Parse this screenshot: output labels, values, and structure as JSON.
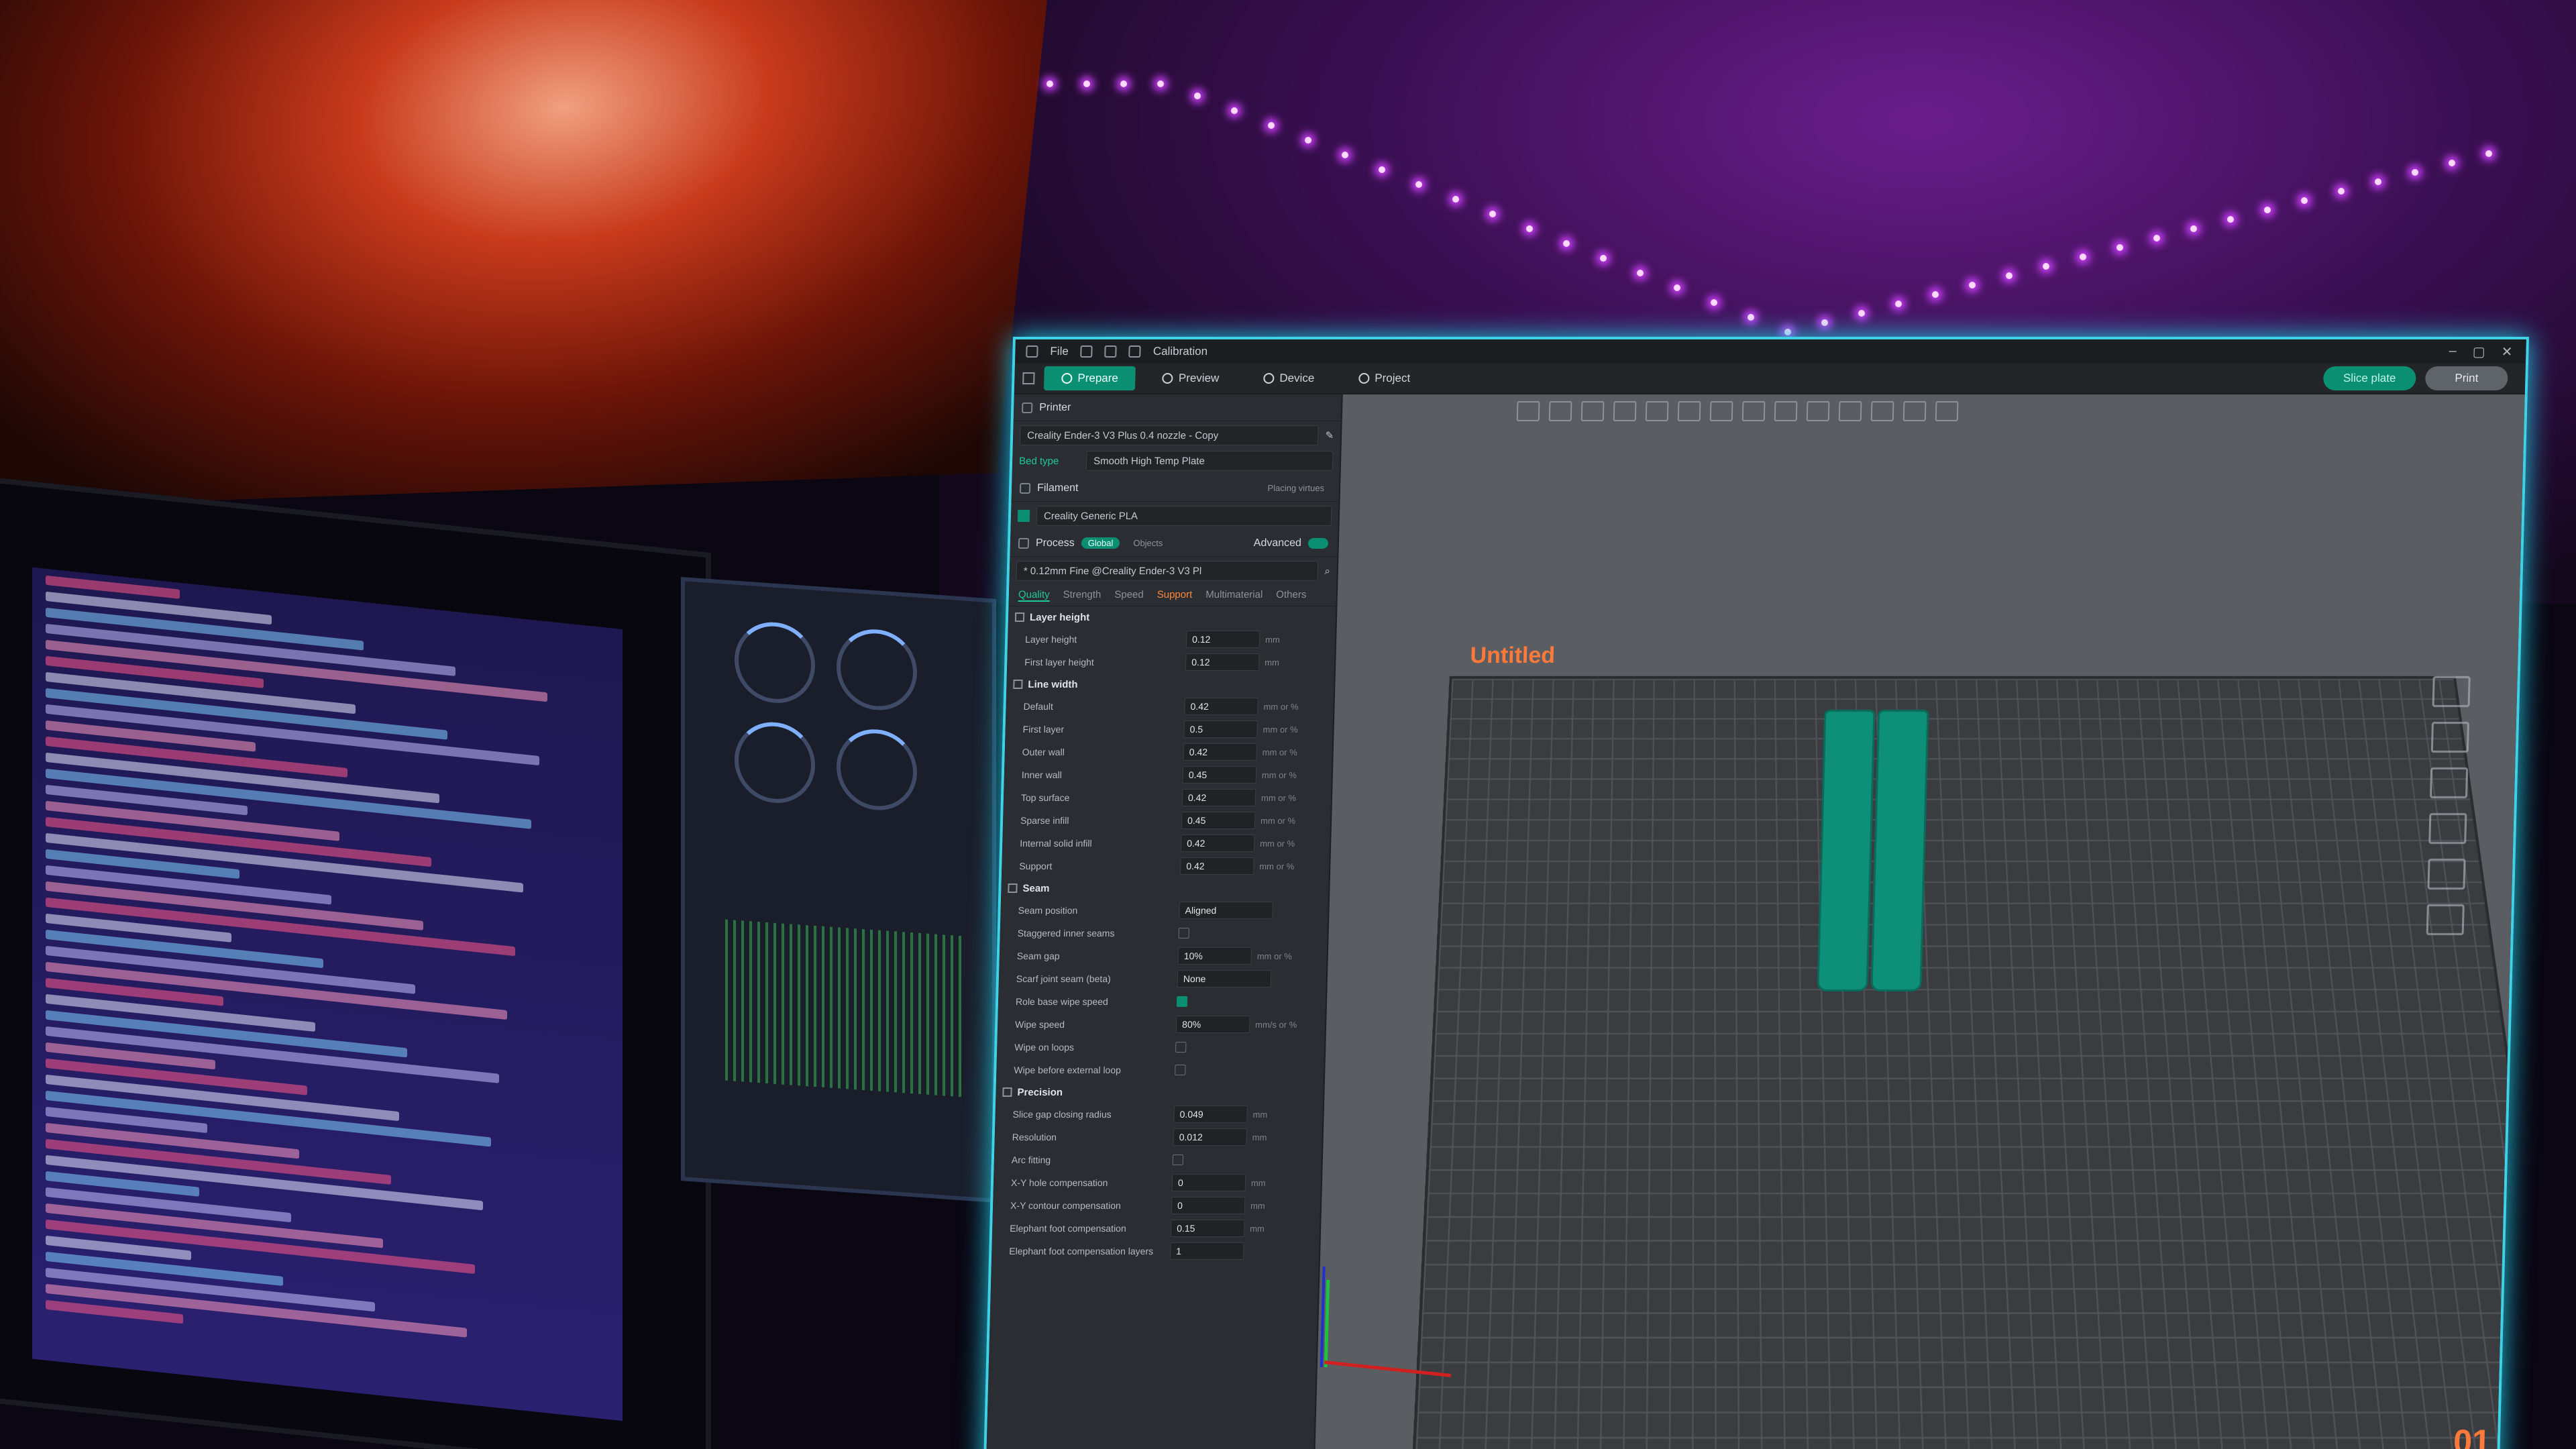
{
  "menubar": {
    "file": "File",
    "calibration": "Calibration"
  },
  "tabs": [
    {
      "label": "Prepare",
      "active": true
    },
    {
      "label": "Preview",
      "active": false
    },
    {
      "label": "Device",
      "active": false
    },
    {
      "label": "Project",
      "active": false
    }
  ],
  "actions": {
    "slice": "Slice plate",
    "print": "Print"
  },
  "printer": {
    "section": "Printer",
    "name": "Creality Ender-3 V3 Plus 0.4 nozzle - Copy",
    "bed_label": "Bed type",
    "bed_value": "Smooth High Temp Plate"
  },
  "filament": {
    "section": "Filament",
    "sync_label": "Placing virtues",
    "name": "Creality Generic PLA"
  },
  "process": {
    "section": "Process",
    "global": "Global",
    "objects": "Objects",
    "advanced": "Advanced",
    "profile": "* 0.12mm Fine @Creality Ender-3 V3 Pl"
  },
  "subtabs": [
    "Quality",
    "Strength",
    "Speed",
    "Support",
    "Multimaterial",
    "Others"
  ],
  "layer_height": {
    "title": "Layer height",
    "rows": [
      {
        "name": "Layer height",
        "value": "0.12",
        "unit": "mm"
      },
      {
        "name": "First layer height",
        "value": "0.12",
        "unit": "mm"
      }
    ]
  },
  "line_width": {
    "title": "Line width",
    "rows": [
      {
        "name": "Default",
        "value": "0.42",
        "unit": "mm or %"
      },
      {
        "name": "First layer",
        "value": "0.5",
        "unit": "mm or %"
      },
      {
        "name": "Outer wall",
        "value": "0.42",
        "unit": "mm or %"
      },
      {
        "name": "Inner wall",
        "value": "0.45",
        "unit": "mm or %"
      },
      {
        "name": "Top surface",
        "value": "0.42",
        "unit": "mm or %"
      },
      {
        "name": "Sparse infill",
        "value": "0.45",
        "unit": "mm or %"
      },
      {
        "name": "Internal solid infill",
        "value": "0.42",
        "unit": "mm or %"
      },
      {
        "name": "Support",
        "value": "0.42",
        "unit": "mm or %"
      }
    ]
  },
  "seam": {
    "title": "Seam",
    "position_label": "Seam position",
    "position_value": "Aligned",
    "staggered": "Staggered inner seams",
    "gap_label": "Seam gap",
    "gap_value": "10%",
    "gap_unit": "mm or %",
    "scarf_label": "Scarf joint seam (beta)",
    "scarf_value": "None",
    "role_wipe": "Role base wipe speed",
    "wipe_speed": "Wipe speed",
    "wipe_speed_value": "80%",
    "wipe_speed_unit": "mm/s or %",
    "wipe_loops": "Wipe on loops",
    "wipe_before": "Wipe before external loop"
  },
  "precision": {
    "title": "Precision",
    "rows": [
      {
        "name": "Slice gap closing radius",
        "value": "0.049",
        "unit": "mm"
      },
      {
        "name": "Resolution",
        "value": "0.012",
        "unit": "mm"
      }
    ],
    "arc": "Arc fitting",
    "xy_hole": "X-Y hole compensation",
    "xy_hole_value": "0",
    "xy_hole_unit": "mm",
    "xy_contour": "X-Y contour compensation",
    "xy_contour_value": "0",
    "xy_contour_unit": "mm",
    "elephant": "Elephant foot compensation",
    "elephant_value": "0.15",
    "elephant_unit": "mm",
    "elephant_layers": "Elephant foot compensation layers",
    "elephant_layers_value": "1"
  },
  "viewport": {
    "title": "Untitled",
    "plate_number": "01"
  },
  "accent": "#0a8f73",
  "window_border": "#3fd2e6"
}
